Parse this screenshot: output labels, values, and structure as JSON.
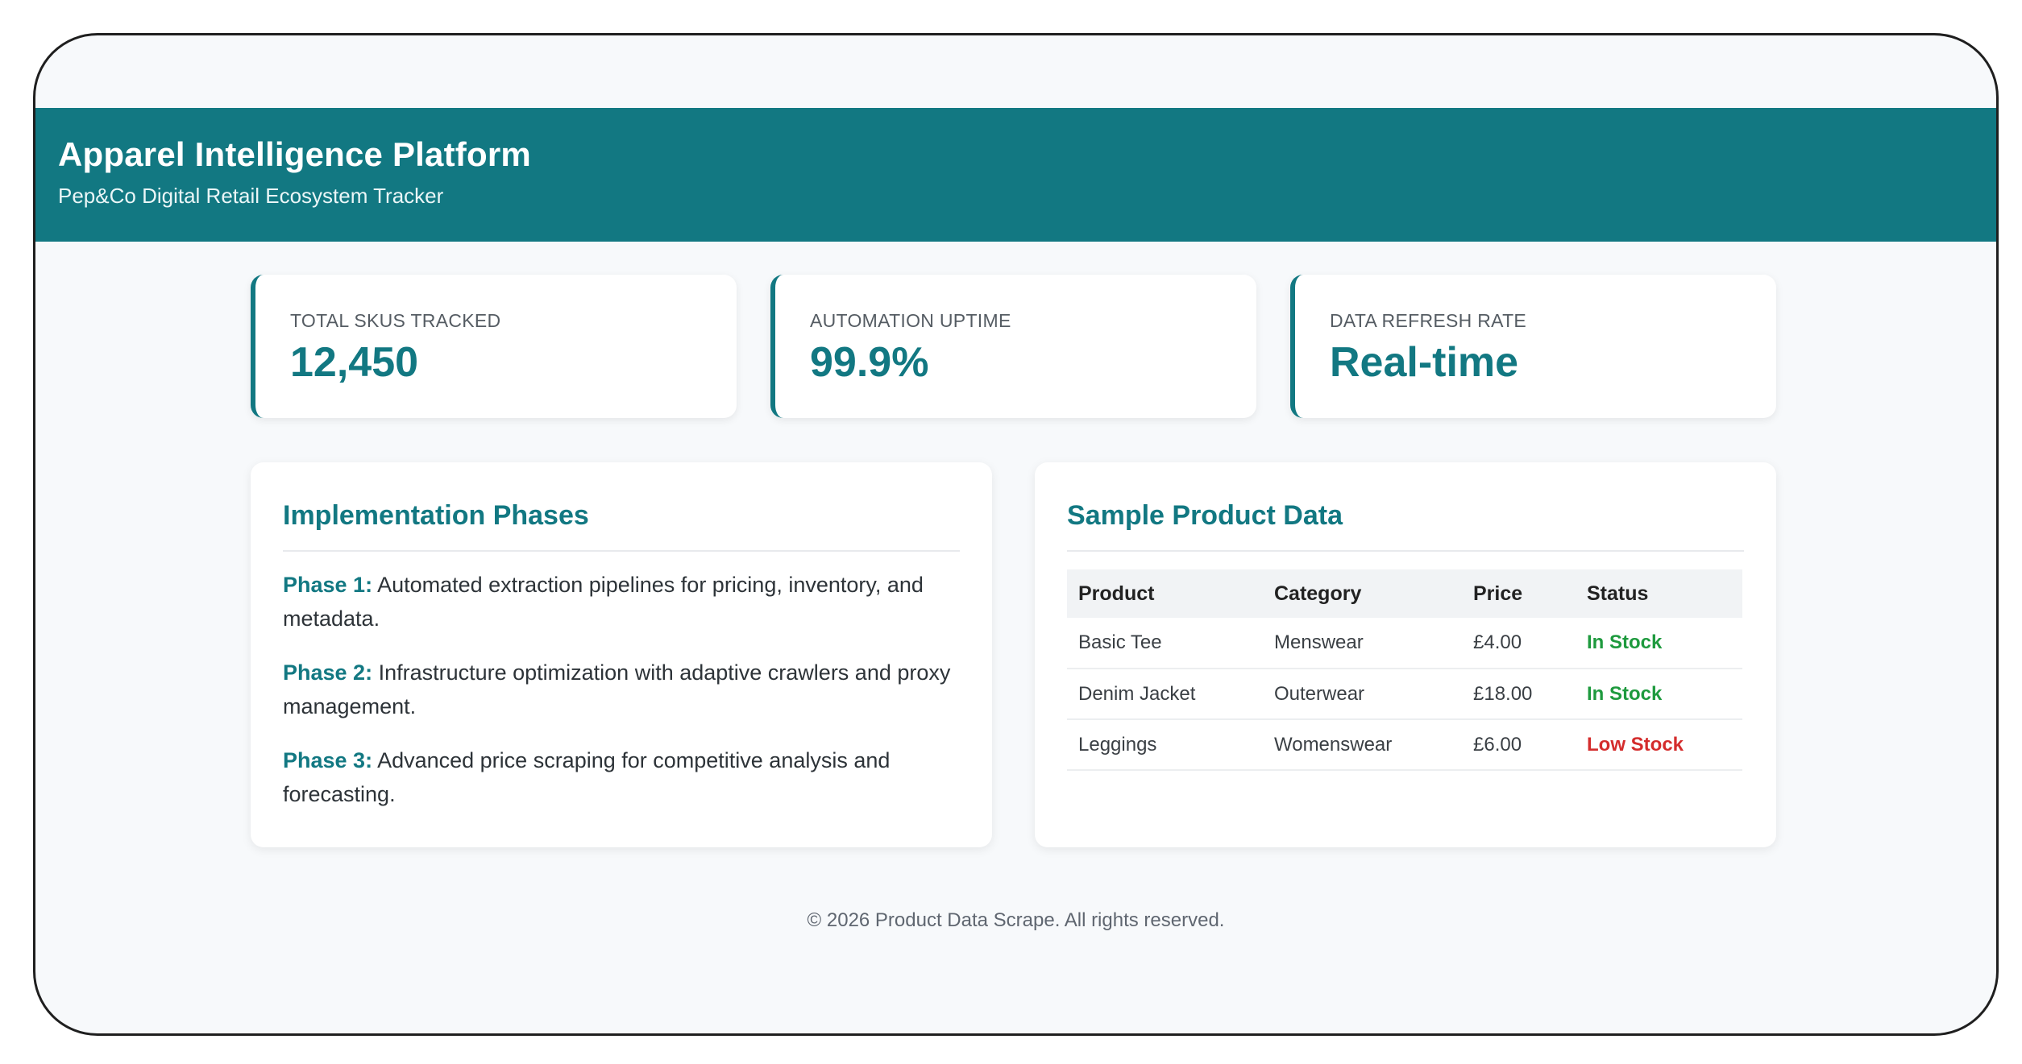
{
  "header": {
    "title": "Apparel Intelligence Platform",
    "subtitle": "Pep&Co Digital Retail Ecosystem Tracker"
  },
  "stats": [
    {
      "label": "TOTAL SKUS TRACKED",
      "value": "12,450"
    },
    {
      "label": "AUTOMATION UPTIME",
      "value": "99.9%"
    },
    {
      "label": "DATA REFRESH RATE",
      "value": "Real-time"
    }
  ],
  "phases": {
    "title": "Implementation Phases",
    "items": [
      {
        "key": "Phase 1:",
        "text": " Automated extraction pipelines for pricing, inventory, and metadata."
      },
      {
        "key": "Phase 2:",
        "text": " Infrastructure optimization with adaptive crawlers and proxy management."
      },
      {
        "key": "Phase 3:",
        "text": " Advanced price scraping for competitive analysis and forecasting."
      }
    ]
  },
  "products": {
    "title": "Sample Product Data",
    "columns": [
      "Product",
      "Category",
      "Price",
      "Status"
    ],
    "rows": [
      {
        "product": "Basic Tee",
        "category": "Menswear",
        "price": "£4.00",
        "status": "In Stock"
      },
      {
        "product": "Denim Jacket",
        "category": "Outerwear",
        "price": "£18.00",
        "status": "In Stock"
      },
      {
        "product": "Leggings",
        "category": "Womenswear",
        "price": "£6.00",
        "status": "Low Stock"
      }
    ]
  },
  "colors": {
    "accent": "#127882",
    "in_stock": "#1e9a3e",
    "low_stock": "#d42c2c"
  },
  "footer": {
    "text": "© 2026 Product Data Scrape. All rights reserved."
  }
}
